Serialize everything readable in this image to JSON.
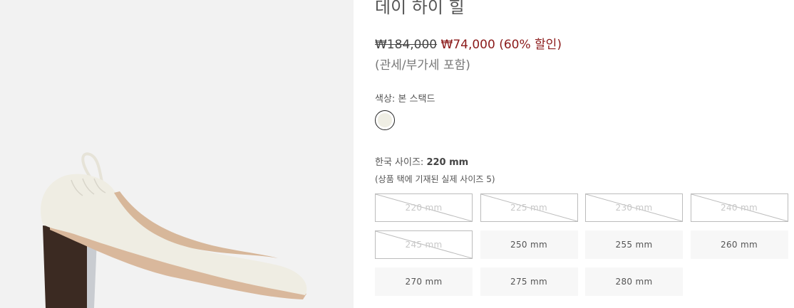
{
  "product": {
    "title": "데이 하이 힐",
    "price": {
      "original": "₩184,000",
      "sale": "₩74,000",
      "discount": "(60% 할인)",
      "tax_note": "(관세/부가세 포함)"
    },
    "color": {
      "label": "색상: 본 스택드",
      "swatch_color": "#efeee4"
    },
    "size": {
      "label_prefix": "한국 사이즈:",
      "selected": "220 mm",
      "note": "(상품 택에 기재된 실제 사이즈 5)",
      "options": [
        {
          "label": "220 mm",
          "sold_out": true
        },
        {
          "label": "225 mm",
          "sold_out": true
        },
        {
          "label": "230 mm",
          "sold_out": true
        },
        {
          "label": "240 mm",
          "sold_out": true
        },
        {
          "label": "245 mm",
          "sold_out": true
        },
        {
          "label": "250 mm",
          "sold_out": false
        },
        {
          "label": "255 mm",
          "sold_out": false
        },
        {
          "label": "260 mm",
          "sold_out": false
        },
        {
          "label": "270 mm",
          "sold_out": false
        },
        {
          "label": "275 mm",
          "sold_out": false
        },
        {
          "label": "280 mm",
          "sold_out": false
        }
      ]
    }
  },
  "colors": {
    "sale_red": "#8b1a1a",
    "image_bg": "#f2f2f2",
    "heel_brown": "#3b2a22",
    "shoe_white": "#efede3"
  }
}
